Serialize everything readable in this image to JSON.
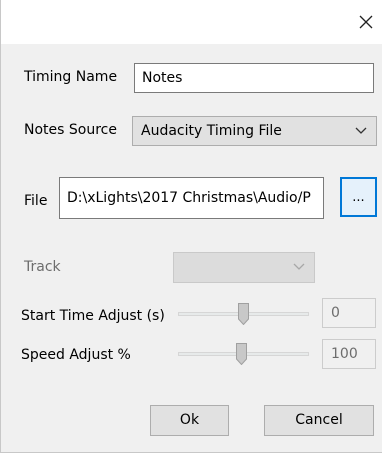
{
  "dialog": {
    "close_glyph": "×",
    "timing_name": {
      "label": "Timing Name",
      "value": "Notes"
    },
    "notes_source": {
      "label": "Notes Source",
      "value": "Audacity Timing File"
    },
    "file": {
      "label": "File",
      "value": "D:\\xLights\\2017 Christmas\\Audio/P",
      "browse_label": "..."
    },
    "track": {
      "label": "Track",
      "value": ""
    },
    "start_time_adjust": {
      "label": "Start Time Adjust (s)",
      "value": "0"
    },
    "speed_adjust": {
      "label": "Speed Adjust %",
      "value": "100"
    },
    "ok_label": "Ok",
    "cancel_label": "Cancel"
  },
  "icons": [
    "close-icon",
    "chevron-down-icon",
    "slider-thumb"
  ],
  "colors": {
    "accent": "#0078d7",
    "dialog_bg": "#f0f0f0",
    "disabled_text": "#6d6d6d"
  }
}
